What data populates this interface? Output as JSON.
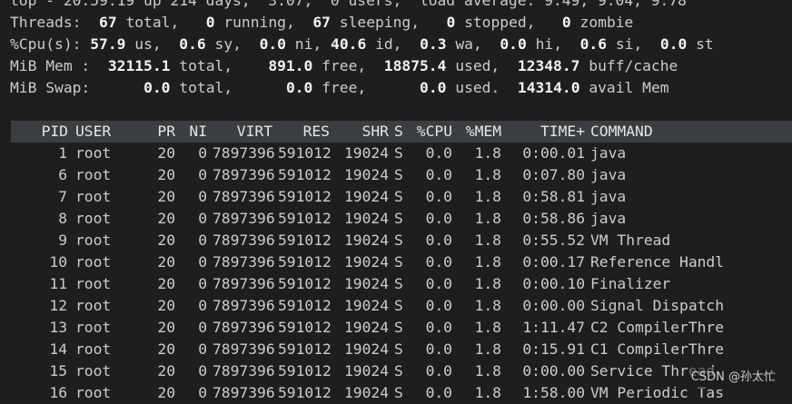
{
  "summary": {
    "top_line": "top - 20:59:19 up 214 days,  3:07,  0 users,  load average: 9.49, 9.04, 9.78",
    "tasks": {
      "label": "Threads:",
      "total": "67",
      "total_label": "total,",
      "running": "0",
      "running_label": "running,",
      "sleeping": "67",
      "sleeping_label": "sleeping,",
      "stopped": "0",
      "stopped_label": "stopped,",
      "zombie": "0",
      "zombie_label": "zombie"
    },
    "cpu": {
      "label": "%Cpu(s):",
      "us": "57.9",
      "us_label": "us,",
      "sy": "0.6",
      "sy_label": "sy,",
      "ni": "0.0",
      "ni_label": "ni,",
      "id": "40.6",
      "id_label": "id,",
      "wa": "0.3",
      "wa_label": "wa,",
      "hi": "0.0",
      "hi_label": "hi,",
      "si": "0.6",
      "si_label": "si,",
      "st": "0.0",
      "st_label": "st"
    },
    "mem": {
      "label": "MiB Mem :",
      "total": "32115.1",
      "total_label": "total,",
      "free": "891.0",
      "free_label": "free,",
      "used": "18875.4",
      "used_label": "used,",
      "buff": "12348.7",
      "buff_label": "buff/cache"
    },
    "swap": {
      "label": "MiB Swap:",
      "total": "0.0",
      "total_label": "total,",
      "free": "0.0",
      "free_label": "free,",
      "used": "0.0",
      "used_label": "used.",
      "avail": "14314.0",
      "avail_label": "avail Mem"
    }
  },
  "columns": [
    "PID",
    "USER",
    "PR",
    "NI",
    "VIRT",
    "RES",
    "SHR",
    "S",
    "%CPU",
    "%MEM",
    "TIME+",
    "COMMAND"
  ],
  "processes": [
    {
      "pid": "1",
      "user": "root",
      "pr": "20",
      "ni": "0",
      "virt": "7897396",
      "res": "591012",
      "shr": "19024",
      "s": "S",
      "cpu": "0.0",
      "mem": "1.8",
      "time": "0:00.01",
      "cmd": "java"
    },
    {
      "pid": "6",
      "user": "root",
      "pr": "20",
      "ni": "0",
      "virt": "7897396",
      "res": "591012",
      "shr": "19024",
      "s": "S",
      "cpu": "0.0",
      "mem": "1.8",
      "time": "0:07.80",
      "cmd": "java"
    },
    {
      "pid": "7",
      "user": "root",
      "pr": "20",
      "ni": "0",
      "virt": "7897396",
      "res": "591012",
      "shr": "19024",
      "s": "S",
      "cpu": "0.0",
      "mem": "1.8",
      "time": "0:58.81",
      "cmd": "java"
    },
    {
      "pid": "8",
      "user": "root",
      "pr": "20",
      "ni": "0",
      "virt": "7897396",
      "res": "591012",
      "shr": "19024",
      "s": "S",
      "cpu": "0.0",
      "mem": "1.8",
      "time": "0:58.86",
      "cmd": "java"
    },
    {
      "pid": "9",
      "user": "root",
      "pr": "20",
      "ni": "0",
      "virt": "7897396",
      "res": "591012",
      "shr": "19024",
      "s": "S",
      "cpu": "0.0",
      "mem": "1.8",
      "time": "0:55.52",
      "cmd": "VM Thread"
    },
    {
      "pid": "10",
      "user": "root",
      "pr": "20",
      "ni": "0",
      "virt": "7897396",
      "res": "591012",
      "shr": "19024",
      "s": "S",
      "cpu": "0.0",
      "mem": "1.8",
      "time": "0:00.17",
      "cmd": "Reference Handl"
    },
    {
      "pid": "11",
      "user": "root",
      "pr": "20",
      "ni": "0",
      "virt": "7897396",
      "res": "591012",
      "shr": "19024",
      "s": "S",
      "cpu": "0.0",
      "mem": "1.8",
      "time": "0:00.10",
      "cmd": "Finalizer"
    },
    {
      "pid": "12",
      "user": "root",
      "pr": "20",
      "ni": "0",
      "virt": "7897396",
      "res": "591012",
      "shr": "19024",
      "s": "S",
      "cpu": "0.0",
      "mem": "1.8",
      "time": "0:00.00",
      "cmd": "Signal Dispatch"
    },
    {
      "pid": "13",
      "user": "root",
      "pr": "20",
      "ni": "0",
      "virt": "7897396",
      "res": "591012",
      "shr": "19024",
      "s": "S",
      "cpu": "0.0",
      "mem": "1.8",
      "time": "1:11.47",
      "cmd": "C2 CompilerThre"
    },
    {
      "pid": "14",
      "user": "root",
      "pr": "20",
      "ni": "0",
      "virt": "7897396",
      "res": "591012",
      "shr": "19024",
      "s": "S",
      "cpu": "0.0",
      "mem": "1.8",
      "time": "0:15.91",
      "cmd": "C1 CompilerThre"
    },
    {
      "pid": "15",
      "user": "root",
      "pr": "20",
      "ni": "0",
      "virt": "7897396",
      "res": "591012",
      "shr": "19024",
      "s": "S",
      "cpu": "0.0",
      "mem": "1.8",
      "time": "0:00.00",
      "cmd": "Service Thread"
    },
    {
      "pid": "16",
      "user": "root",
      "pr": "20",
      "ni": "0",
      "virt": "7897396",
      "res": "591012",
      "shr": "19024",
      "s": "S",
      "cpu": "0.0",
      "mem": "1.8",
      "time": "1:58.00",
      "cmd": "VM Periodic Tas"
    }
  ],
  "watermark": "CSDN @孙太忙"
}
